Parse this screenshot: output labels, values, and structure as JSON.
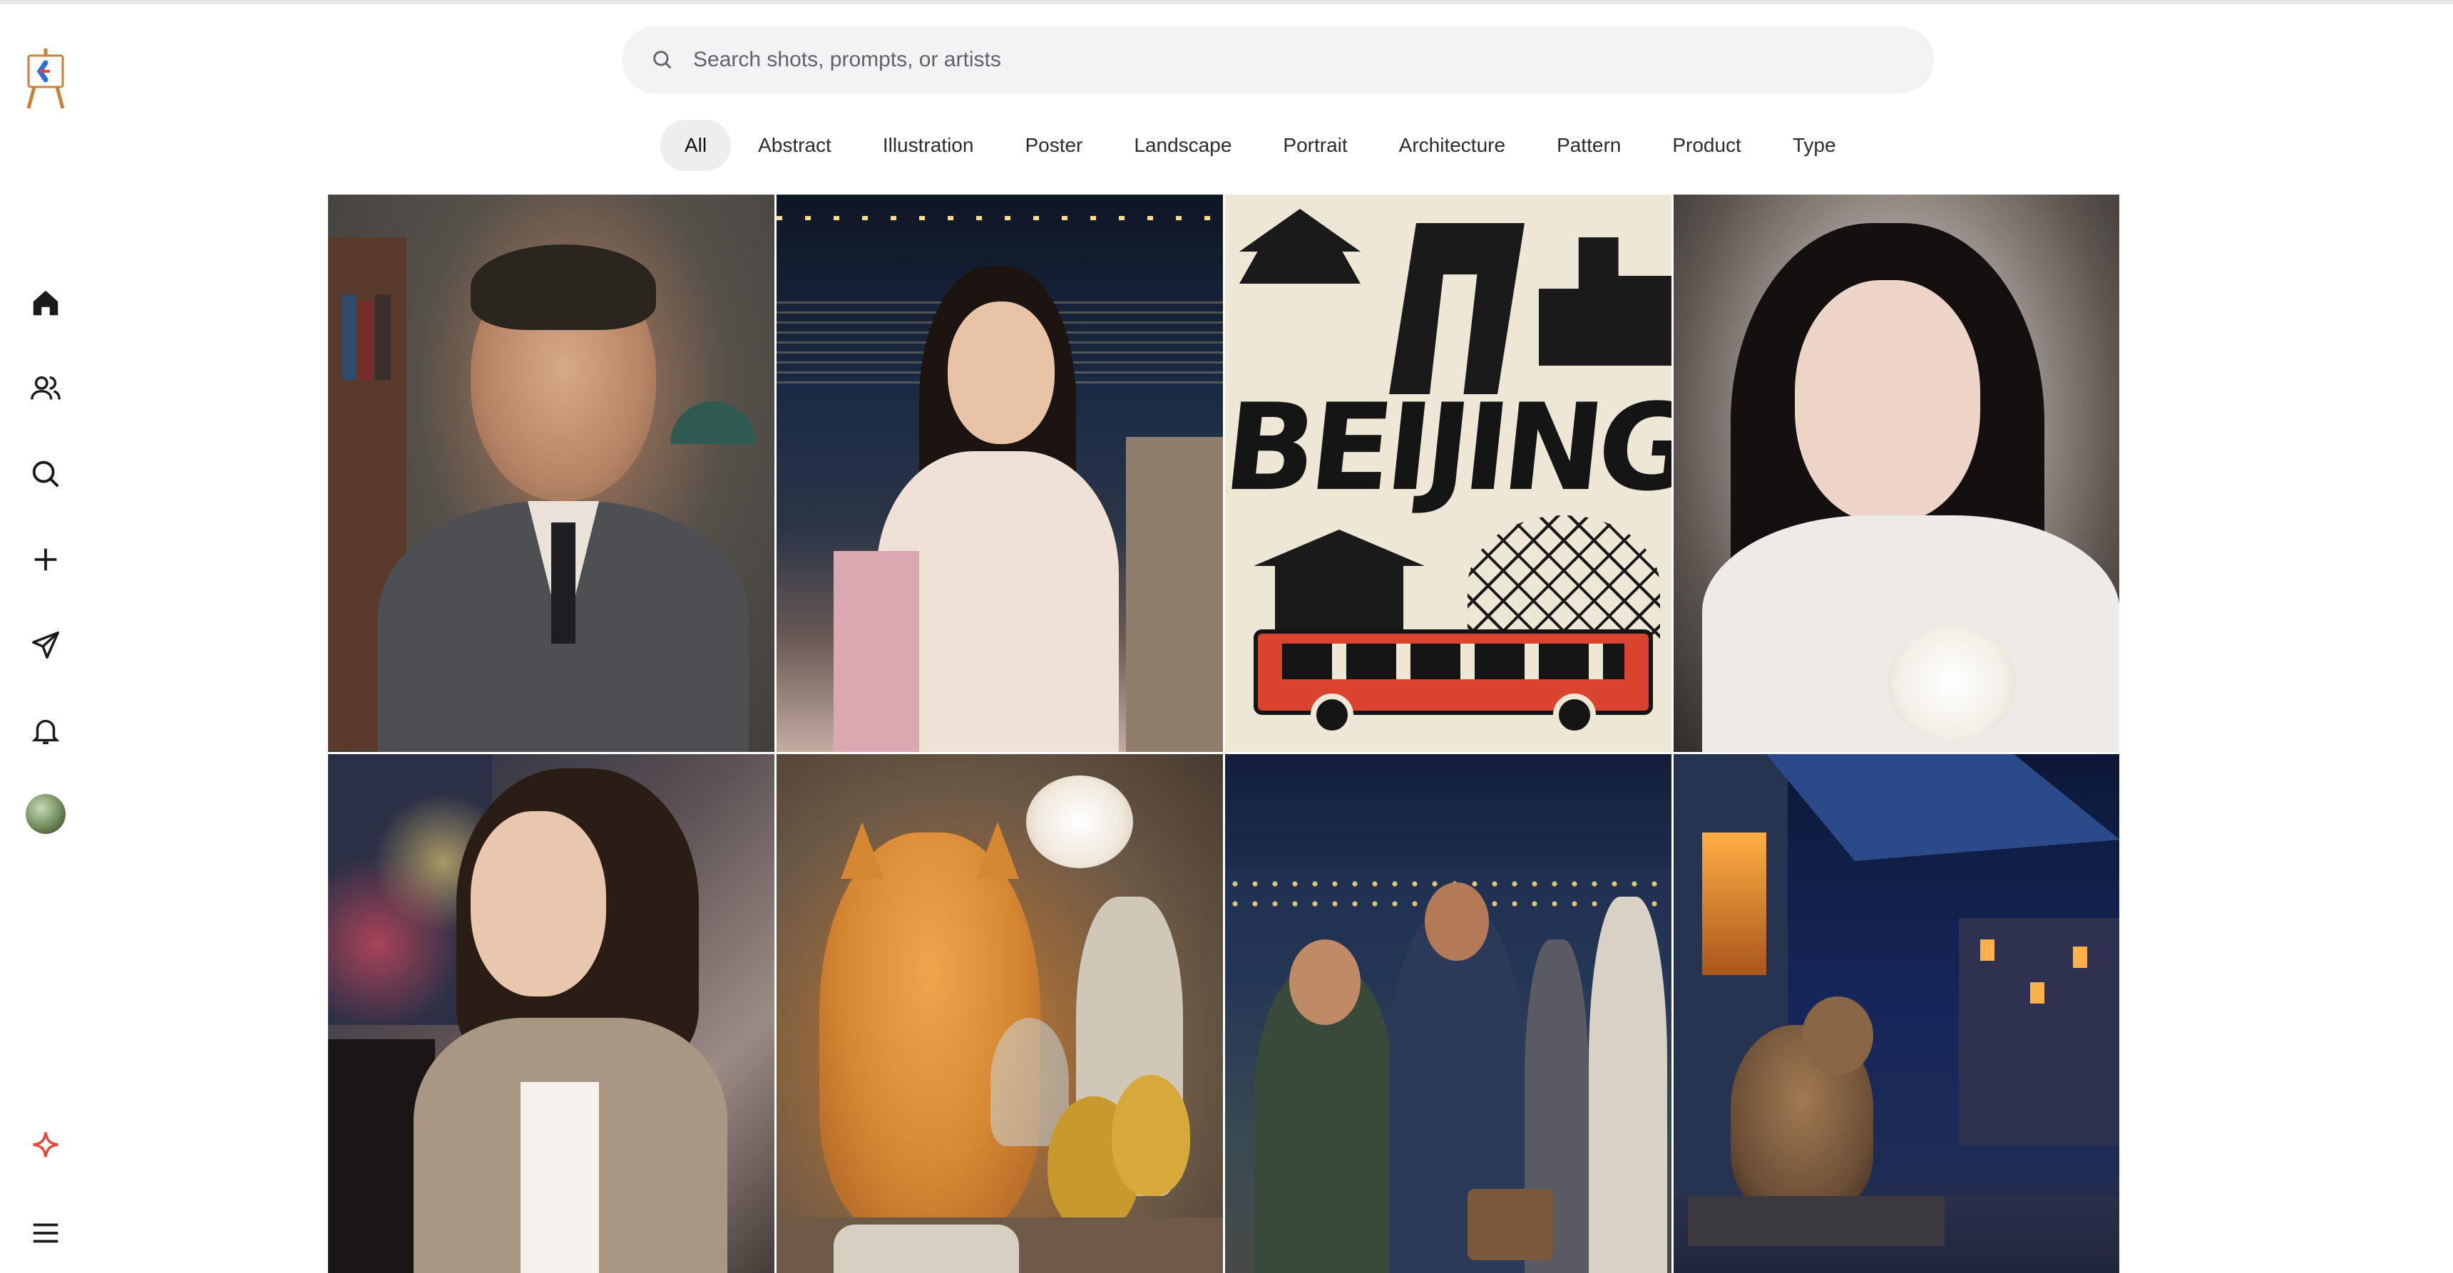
{
  "search": {
    "placeholder": "Search shots, prompts, or artists",
    "icon": "search-icon"
  },
  "sidebar": {
    "logo": "easel-logo",
    "items": [
      {
        "icon": "home-icon"
      },
      {
        "icon": "people-icon"
      },
      {
        "icon": "search-icon"
      },
      {
        "icon": "plus-icon"
      },
      {
        "icon": "send-icon"
      },
      {
        "icon": "bell-icon"
      },
      {
        "icon": "avatar"
      }
    ],
    "bottom": [
      {
        "icon": "sparkle-icon",
        "color": "#e8453c"
      },
      {
        "icon": "menu-icon"
      }
    ]
  },
  "categories": [
    "All",
    "Abstract",
    "Illustration",
    "Poster",
    "Landscape",
    "Portrait",
    "Architecture",
    "Pattern",
    "Product",
    "Type"
  ],
  "active_category": "All",
  "gallery": {
    "tiles": [
      {
        "alt": "elderly man portrait"
      },
      {
        "alt": "girl by river at night"
      },
      {
        "alt": "beijing poster",
        "text": "BEIJING"
      },
      {
        "alt": "selfie woman"
      },
      {
        "alt": "woman in car"
      },
      {
        "alt": "orange cat still life"
      },
      {
        "alt": "friends with lights"
      },
      {
        "alt": "cat in rainy night"
      }
    ]
  }
}
